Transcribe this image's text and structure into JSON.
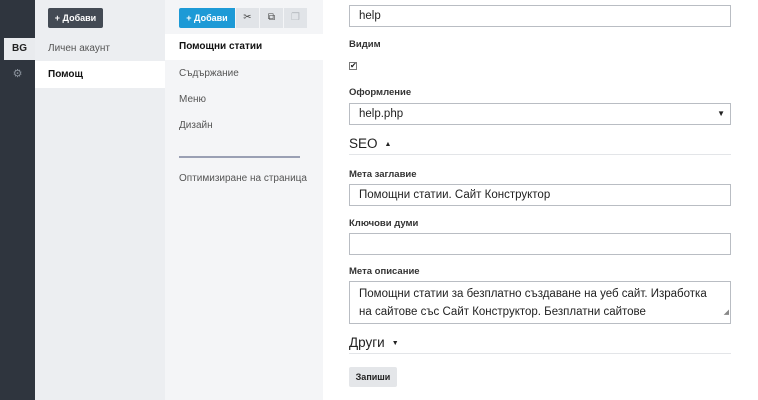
{
  "rail": {
    "lang": "BG",
    "gear_icon": "gear-icon"
  },
  "col2": {
    "add_label": "+ Добави",
    "items": [
      {
        "label": "Личен акаунт"
      },
      {
        "label": "Помощ"
      }
    ]
  },
  "col3": {
    "add_label": "+ Добави",
    "tools": [
      "✂",
      "⧉",
      "❐"
    ],
    "items": [
      {
        "label": "Помощни статии"
      },
      {
        "label": "Съдържание"
      },
      {
        "label": "Меню"
      },
      {
        "label": "Дизайн"
      }
    ],
    "extra": "Оптимизиране на страница"
  },
  "form": {
    "slug_value": "help",
    "visible_label": "Видим",
    "visible_checked": "✔",
    "layout_label": "Оформление",
    "layout_value": "help.php",
    "seo_header": "SEO",
    "seo_caret": "▲",
    "meta_title_label": "Мета заглавие",
    "meta_title_value": "Помощни статии. Сайт Конструктор",
    "keywords_label": "Ключови думи",
    "keywords_value": "",
    "meta_desc_label": "Мета описание",
    "meta_desc_value": "Помощни статии за безплатно създаване на уеб сайт. Изработка на сайтове със Сайт Конструктор. Безплатни сайтове",
    "other_header": "Други",
    "other_caret": "▼",
    "save_label": "Запиши"
  }
}
